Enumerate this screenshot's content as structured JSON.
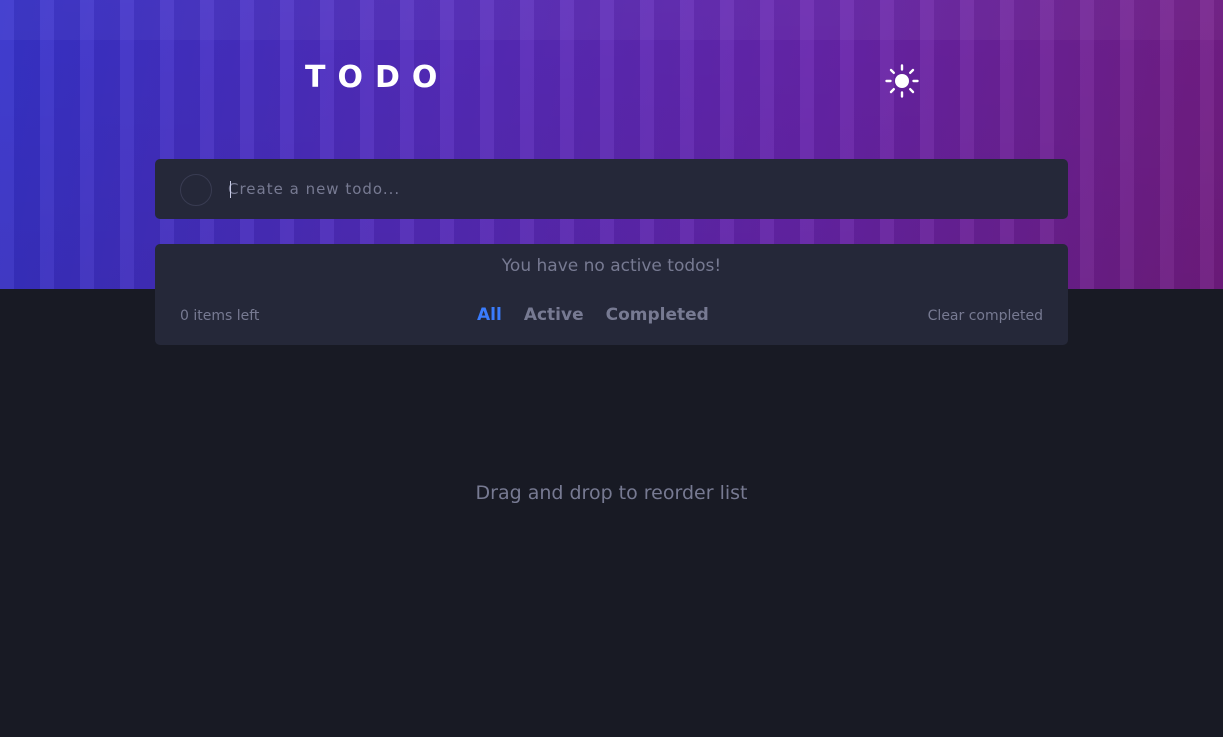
{
  "header": {
    "title": "TODO"
  },
  "theme_toggle": {
    "icon": "sun-icon"
  },
  "new_todo": {
    "placeholder": "Create a new todo...",
    "value": ""
  },
  "list": {
    "empty_message": "You have no active todos!",
    "items": []
  },
  "footer": {
    "items_left": "0 items left",
    "filters": [
      "All",
      "Active",
      "Completed"
    ],
    "active_filter": "All",
    "clear_label": "Clear completed"
  },
  "hint": "Drag and drop to reorder list",
  "colors": {
    "background": "#181a24",
    "card": "#252839",
    "accent": "#3a7cfd",
    "muted_text": "#777a92",
    "gradient_start": "#3a36d8",
    "gradient_end": "#7c1f8c"
  }
}
